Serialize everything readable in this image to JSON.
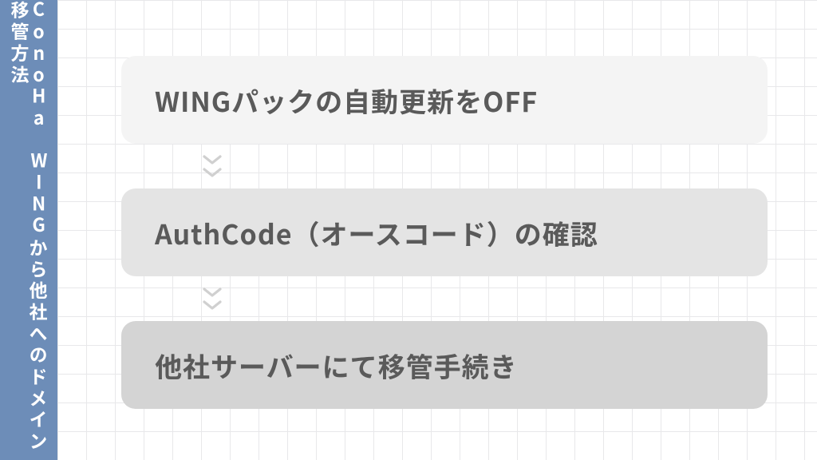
{
  "sidebar": {
    "title": "ConoHa WINGから他社へのドメイン移管方法"
  },
  "steps": [
    {
      "label": "WINGパックの自動更新をOFF",
      "shade": "step-1"
    },
    {
      "label": "AuthCode（オースコード）の確認",
      "shade": "step-2"
    },
    {
      "label": "他社サーバーにて移管手続き",
      "shade": "step-3"
    }
  ],
  "colors": {
    "sidebar_bg": "#6d8db8",
    "grid_line": "#e8e8ea",
    "text": "#5a5a5a"
  }
}
